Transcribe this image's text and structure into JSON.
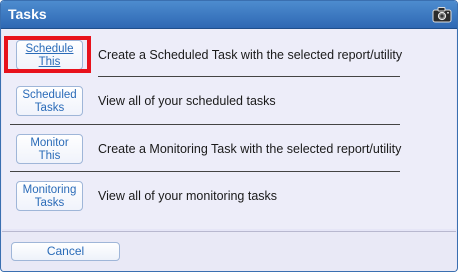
{
  "dialog": {
    "title": "Tasks",
    "title_icon": "camera-icon"
  },
  "rows": [
    {
      "button_line1": "Schedule",
      "button_line2": "This",
      "description": "Create a Scheduled Task with the selected report/utility"
    },
    {
      "button_line1": "Scheduled",
      "button_line2": "Tasks",
      "description": "View all of your scheduled tasks"
    },
    {
      "button_line1": "Monitor",
      "button_line2": "This",
      "description": "Create a Monitoring Task with the selected report/utility"
    },
    {
      "button_line1": "Monitoring",
      "button_line2": "Tasks",
      "description": "View all of your monitoring tasks"
    }
  ],
  "footer": {
    "cancel_label": "Cancel"
  },
  "colors": {
    "titlebar": "#3a78c0",
    "highlight": "#e8121c",
    "link_text": "#2a6bb8"
  }
}
